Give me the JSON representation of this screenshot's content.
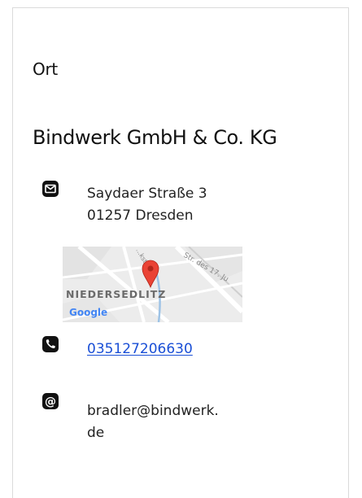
{
  "location": {
    "heading": "Ort",
    "company_name": "Bindwerk GmbH & Co. KG",
    "address": {
      "street": "Saydaer Straße 3",
      "city_line": "01257 Dresden"
    },
    "map": {
      "district_label": "NIEDERSEDLITZ",
      "street_label_1": "Str. des 17. Ju",
      "street_label_2": "...kstraße",
      "provider_label": "Google",
      "pin_color": "#ea4335"
    },
    "phone": "035127206630",
    "email": "bradler@bindwerk.de"
  },
  "icons": {
    "address": "envelope-icon",
    "phone": "phone-icon",
    "email": "at-icon"
  },
  "colors": {
    "link": "#1a4fd6",
    "text": "#222222",
    "icon": "#111111"
  }
}
